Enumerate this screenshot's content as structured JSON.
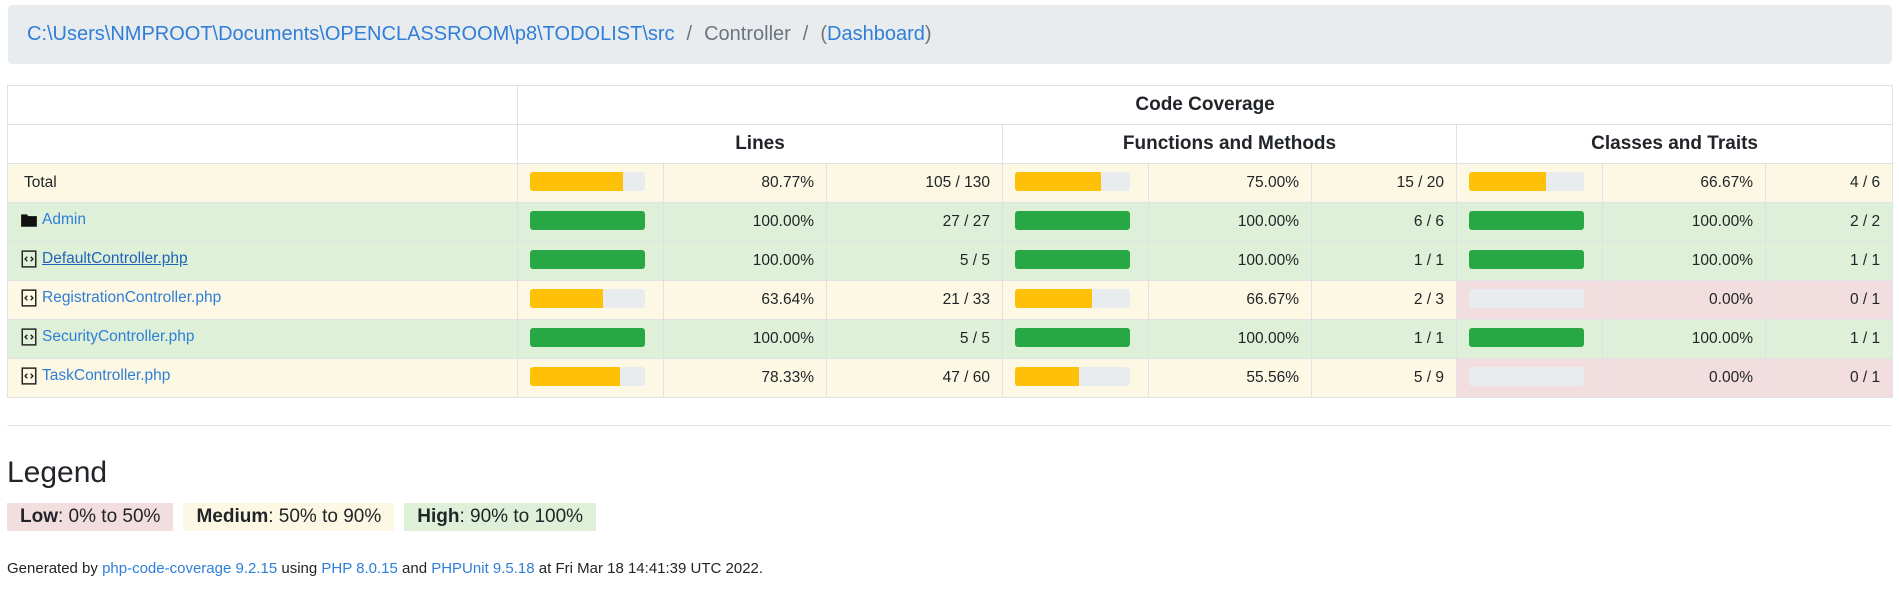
{
  "breadcrumb": {
    "path": "C:\\Users\\NMPROOT\\Documents\\OPENCLASSROOM\\p8\\TODOLIST\\src",
    "separator": "/",
    "current": "Controller",
    "dashboard_open": "(",
    "dashboard_link": "Dashboard",
    "dashboard_close": ")"
  },
  "table": {
    "group_header": "Code Coverage",
    "column_headers": [
      "Lines",
      "Functions and Methods",
      "Classes and Traits"
    ],
    "rows": [
      {
        "name": "Total",
        "icon": "none",
        "level": "med",
        "lines": {
          "pct": "80.77%",
          "count": "105 / 130",
          "fill": 0.8077,
          "level": "med"
        },
        "methods": {
          "pct": "75.00%",
          "count": "15 / 20",
          "fill": 0.75,
          "level": "med"
        },
        "classes": {
          "pct": "66.67%",
          "count": "4 / 6",
          "fill": 0.6667,
          "level": "med"
        }
      },
      {
        "name": "Admin",
        "icon": "folder-icon",
        "level": "high",
        "lines": {
          "pct": "100.00%",
          "count": "27 / 27",
          "fill": 1.0,
          "level": "high"
        },
        "methods": {
          "pct": "100.00%",
          "count": "6 / 6",
          "fill": 1.0,
          "level": "high"
        },
        "classes": {
          "pct": "100.00%",
          "count": "2 / 2",
          "fill": 1.0,
          "level": "high"
        }
      },
      {
        "name": "DefaultController.php",
        "icon": "code-file-icon",
        "level": "high",
        "lines": {
          "pct": "100.00%",
          "count": "5 / 5",
          "fill": 1.0,
          "level": "high"
        },
        "methods": {
          "pct": "100.00%",
          "count": "1 / 1",
          "fill": 1.0,
          "level": "high"
        },
        "classes": {
          "pct": "100.00%",
          "count": "1 / 1",
          "fill": 1.0,
          "level": "high"
        }
      },
      {
        "name": "RegistrationController.php",
        "icon": "code-file-icon",
        "level": "med",
        "lines": {
          "pct": "63.64%",
          "count": "21 / 33",
          "fill": 0.6364,
          "level": "med"
        },
        "methods": {
          "pct": "66.67%",
          "count": "2 / 3",
          "fill": 0.6667,
          "level": "med"
        },
        "classes": {
          "pct": "0.00%",
          "count": "0 / 1",
          "fill": 0.0,
          "level": "low"
        }
      },
      {
        "name": "SecurityController.php",
        "icon": "code-file-icon",
        "level": "high",
        "lines": {
          "pct": "100.00%",
          "count": "5 / 5",
          "fill": 1.0,
          "level": "high"
        },
        "methods": {
          "pct": "100.00%",
          "count": "1 / 1",
          "fill": 1.0,
          "level": "high"
        },
        "classes": {
          "pct": "100.00%",
          "count": "1 / 1",
          "fill": 1.0,
          "level": "high"
        }
      },
      {
        "name": "TaskController.php",
        "icon": "code-file-icon",
        "level": "med",
        "lines": {
          "pct": "78.33%",
          "count": "47 / 60",
          "fill": 0.7833,
          "level": "med"
        },
        "methods": {
          "pct": "55.56%",
          "count": "5 / 9",
          "fill": 0.5556,
          "level": "med"
        },
        "classes": {
          "pct": "0.00%",
          "count": "0 / 1",
          "fill": 0.0,
          "level": "low"
        }
      }
    ]
  },
  "legend": {
    "title": "Legend",
    "low_label": "Low",
    "low_range": ": 0% to 50%",
    "medium_label": "Medium",
    "medium_range": ": 50% to 90%",
    "high_label": "High",
    "high_range": ": 90% to 100%"
  },
  "footer": {
    "prefix": "Generated by ",
    "tool_link": "php-code-coverage 9.2.15",
    "using": " using ",
    "php_link": "PHP 8.0.15",
    "and": " and ",
    "phpunit_link": "PHPUnit 9.5.18",
    "suffix": " at Fri Mar 18 14:41:39 UTC 2022."
  },
  "colors": {
    "high_bar": "#28a745",
    "medium_bar": "#ffc107",
    "high_bg": "#dff0d8",
    "medium_bg": "#fcf8e3",
    "low_bg": "#f2dede",
    "link": "#2f7ed8"
  }
}
